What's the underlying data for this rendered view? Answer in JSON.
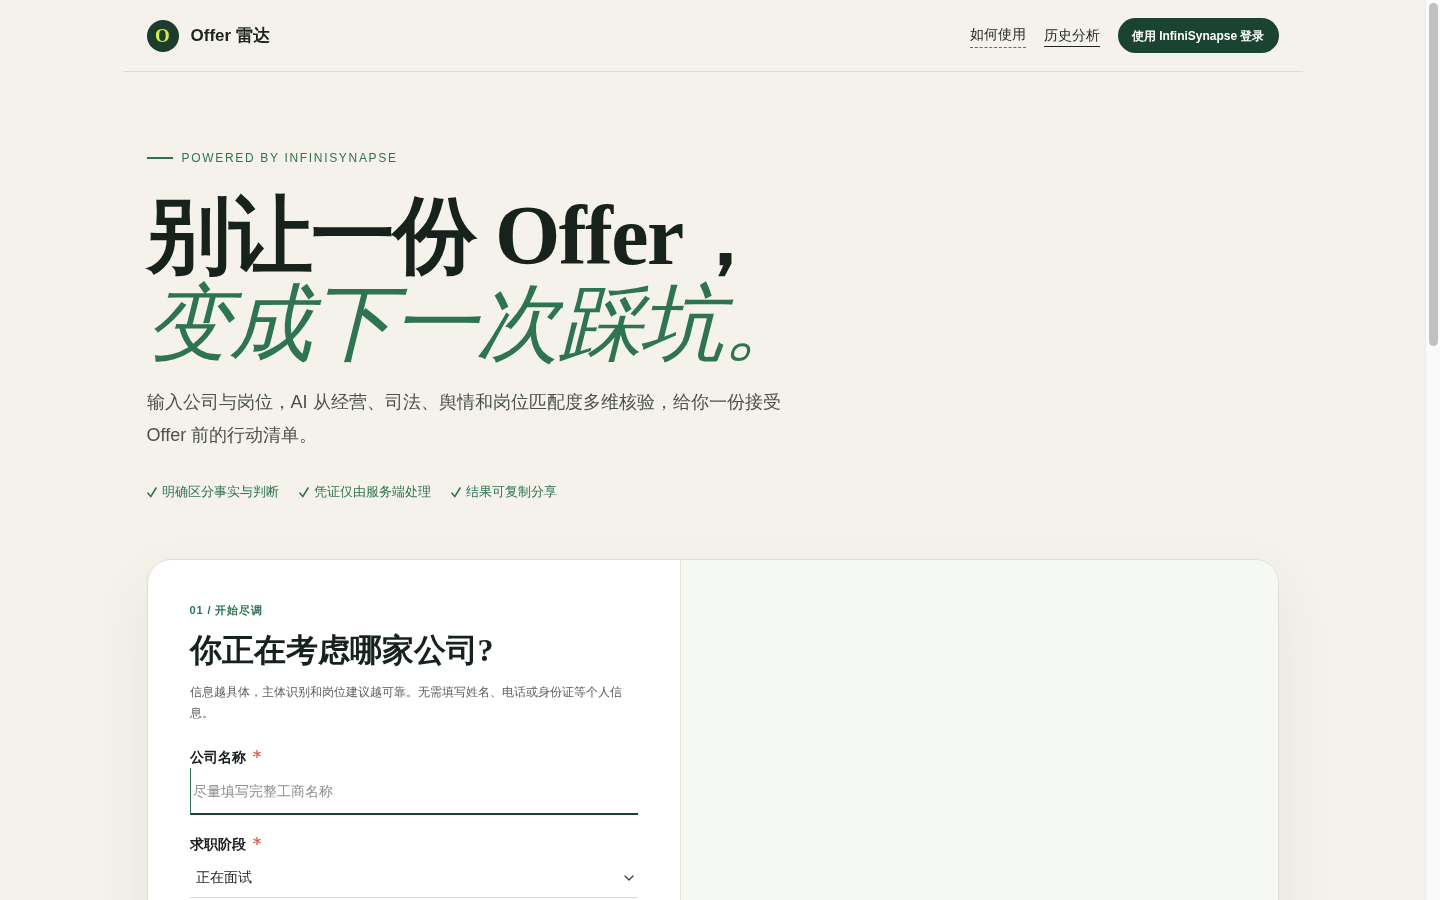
{
  "header": {
    "brand": {
      "logo_letter": "O",
      "name": "Offer 雷达"
    },
    "nav": [
      {
        "label": "如何使用",
        "kind": "help"
      },
      {
        "label": "历史分析",
        "kind": "link"
      }
    ],
    "login_button": "使用 InfiniSynapse 登录"
  },
  "hero": {
    "eyebrow": "POWERED BY INFINISYNAPSE",
    "title_line_1": "别让一份 Offer，",
    "title_line_2": "变成下一次踩坑。",
    "subtitle": "输入公司与岗位，AI 从经营、司法、舆情和岗位匹配度多维核验，给你一份接受 Offer 前的行动清单。",
    "highlights": [
      "明确区分事实与判断",
      "凭证仅由服务端处理",
      "结果可复制分享"
    ]
  },
  "form_card": {
    "step": "01 / 开始尽调",
    "heading": "你正在考虑哪家公司?",
    "description": "信息越具体，主体识别和岗位建议越可靠。无需填写姓名、电话或身份证等个人信息。",
    "fields": [
      {
        "label": "公司名称",
        "required": true,
        "kind": "text",
        "placeholder": "尽量填写完整工商名称"
      },
      {
        "label": "求职阶段",
        "required": true,
        "kind": "select",
        "value": "正在面试"
      }
    ]
  }
}
